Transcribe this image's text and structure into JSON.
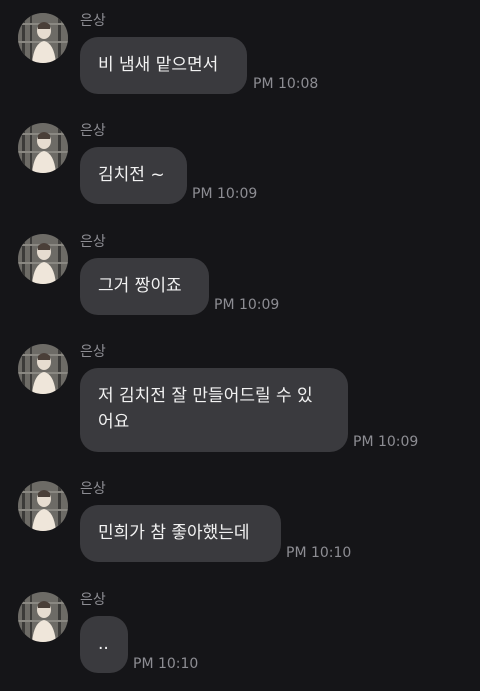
{
  "messages": [
    {
      "sender": "은상",
      "text": "비 냄새 맡으면서",
      "time": "PM 10:08"
    },
    {
      "sender": "은상",
      "text": "김치전 ~",
      "time": "PM 10:09"
    },
    {
      "sender": "은상",
      "text": "그거 짱이죠",
      "time": "PM 10:09"
    },
    {
      "sender": "은상",
      "text": "저 김치전 잘 만들어드릴 수 있\n어요",
      "time": "PM 10:09"
    },
    {
      "sender": "은상",
      "text": "민희가 참 좋아했는데",
      "time": "PM 10:10"
    },
    {
      "sender": "은상",
      "text": "..",
      "time": "PM 10:10"
    }
  ],
  "colors": {
    "background": "#151518",
    "bubble": "#3a3a3e",
    "meta_text": "#8d8d93",
    "message_text": "#f2f2f2"
  },
  "icons": {
    "avatar": "profile-photo-avatar"
  }
}
